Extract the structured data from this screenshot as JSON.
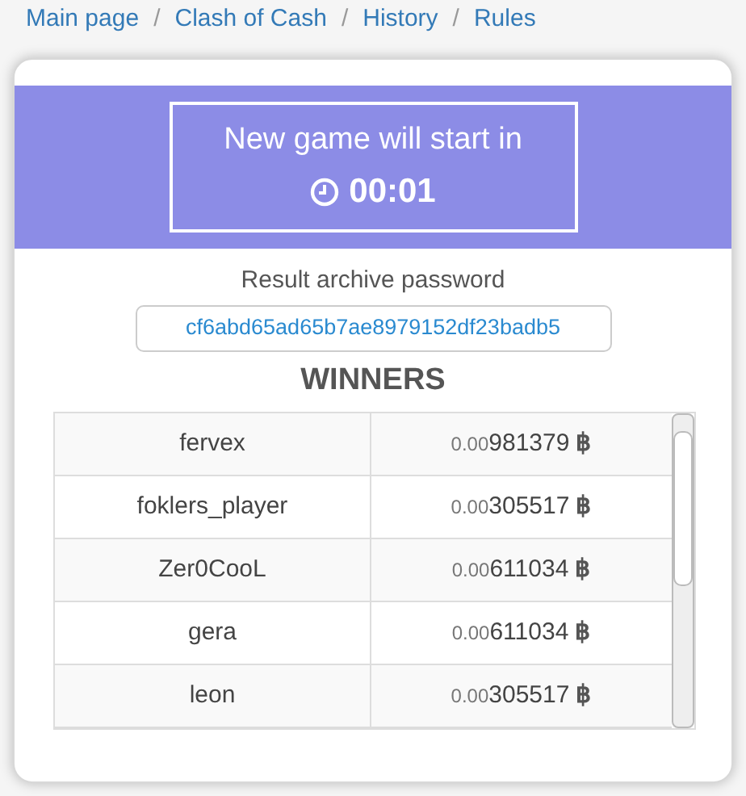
{
  "breadcrumb": {
    "separator": "/",
    "items": [
      {
        "label": "Main page"
      },
      {
        "label": "Clash of Cash"
      },
      {
        "label": "History"
      },
      {
        "label": "Rules"
      }
    ]
  },
  "countdown": {
    "title": "New game will start in",
    "time": "00:01"
  },
  "password": {
    "label": "Result archive password",
    "value": "cf6abd65ad65b7ae8979152df23badb5"
  },
  "winners": {
    "title": "WINNERS",
    "rows": [
      {
        "name": "fervex",
        "prefix": "0.00",
        "amount": "981379",
        "currency": "฿"
      },
      {
        "name": "foklers_player",
        "prefix": "0.00",
        "amount": "305517",
        "currency": "฿"
      },
      {
        "name": "Zer0CooL",
        "prefix": "0.00",
        "amount": "611034",
        "currency": "฿"
      },
      {
        "name": "gera",
        "prefix": "0.00",
        "amount": "611034",
        "currency": "฿"
      },
      {
        "name": "leon",
        "prefix": "0.00",
        "amount": "305517",
        "currency": "฿"
      }
    ]
  }
}
